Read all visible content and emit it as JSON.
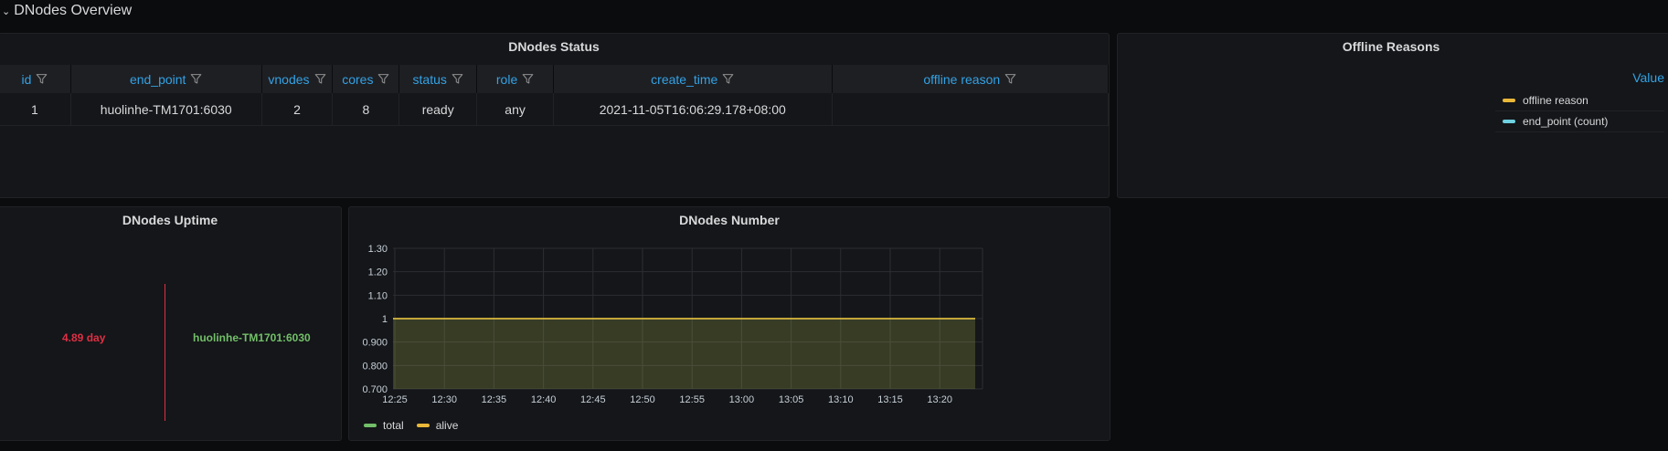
{
  "row": {
    "title": "DNodes Overview"
  },
  "status_panel": {
    "title": "DNodes Status",
    "columns": [
      "id",
      "end_point",
      "vnodes",
      "cores",
      "status",
      "role",
      "create_time",
      "offline reason"
    ],
    "rows": [
      [
        "1",
        "huolinhe-TM1701:6030",
        "2",
        "8",
        "ready",
        "any",
        "2021-11-05T16:06:29.178+08:00",
        ""
      ]
    ]
  },
  "offline_panel": {
    "title": "Offline Reasons",
    "legend_header": "Value",
    "legend": [
      {
        "label": "offline reason",
        "color": "#eab839"
      },
      {
        "label": "end_point (count)",
        "color": "#6ed0e0"
      }
    ]
  },
  "uptime_panel": {
    "title": "DNodes Uptime",
    "value": "4.89 day",
    "value_color": "#e02f44",
    "name": "huolinhe-TM1701:6030",
    "name_color": "#73bf69"
  },
  "number_panel": {
    "title": "DNodes Number"
  },
  "chart_data": {
    "type": "area",
    "title": "DNodes Number",
    "x": [
      "12:25",
      "12:30",
      "12:35",
      "12:40",
      "12:45",
      "12:50",
      "12:55",
      "13:00",
      "13:05",
      "13:10",
      "13:15",
      "13:20"
    ],
    "y_ticks": [
      "1.30",
      "1.20",
      "1.10",
      "1",
      "0.900",
      "0.800",
      "0.700"
    ],
    "ylim": [
      0.7,
      1.3
    ],
    "grid": true,
    "legend_position": "bottom-left",
    "series": [
      {
        "name": "total",
        "color": "#73bf69",
        "values": [
          1,
          1,
          1,
          1,
          1,
          1,
          1,
          1,
          1,
          1,
          1,
          1,
          1
        ]
      },
      {
        "name": "alive",
        "color": "#eab839",
        "values": [
          1,
          1,
          1,
          1,
          1,
          1,
          1,
          1,
          1,
          1,
          1,
          1,
          1
        ]
      }
    ]
  }
}
